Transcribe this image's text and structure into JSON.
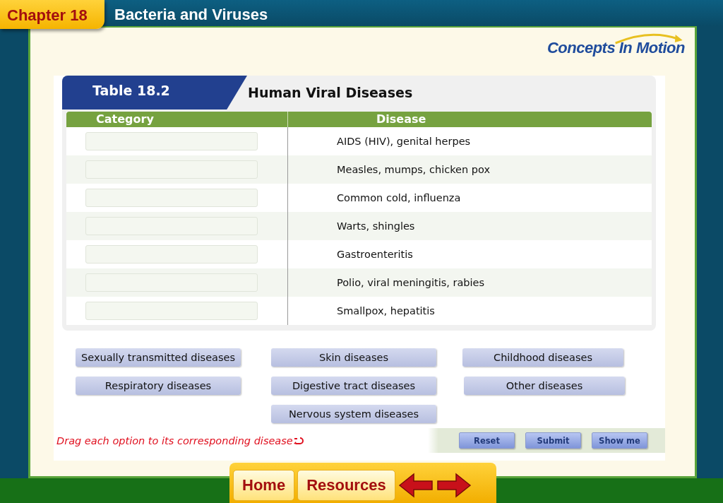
{
  "header": {
    "chapter": "Chapter 18",
    "title": "Bacteria and Viruses"
  },
  "logo": {
    "text": "Concepts In Motion"
  },
  "table": {
    "label": "Table 18.2",
    "title": "Human Viral Diseases",
    "columns": [
      "Category",
      "Disease"
    ],
    "rows": [
      {
        "disease": "AIDS (HIV), genital herpes"
      },
      {
        "disease": "Measles, mumps, chicken pox"
      },
      {
        "disease": "Common cold, influenza"
      },
      {
        "disease": "Warts, shingles"
      },
      {
        "disease": "Gastroenteritis"
      },
      {
        "disease": "Polio, viral meningitis, rabies"
      },
      {
        "disease": "Smallpox, hepatitis"
      }
    ]
  },
  "options": [
    "Sexually transmitted diseases",
    "Skin diseases",
    "Childhood diseases",
    "Respiratory diseases",
    "Digestive tract diseases",
    "Other diseases",
    "Nervous system diseases"
  ],
  "instruction": "Drag each option to its corresponding disease",
  "buttons": [
    "Reset",
    "Submit",
    "Show me"
  ],
  "nav": {
    "buttons": [
      "Home",
      "Resources"
    ]
  }
}
